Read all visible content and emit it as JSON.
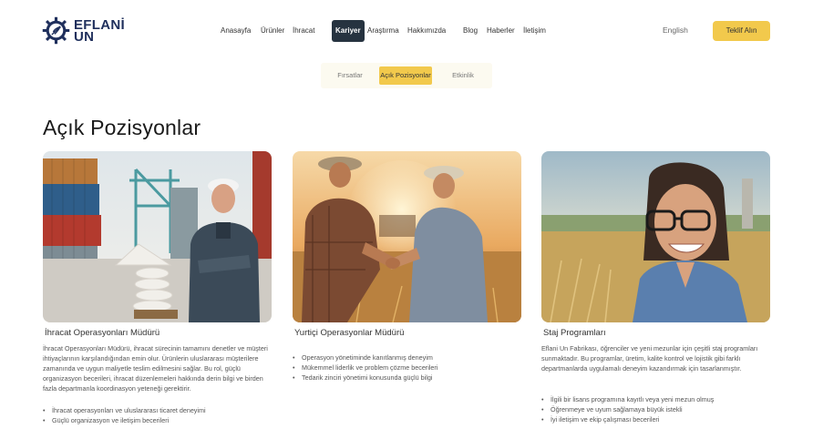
{
  "logo": {
    "line1": "EFLANİ",
    "line2": "UN"
  },
  "nav": {
    "items": [
      {
        "label": "Anasayfa"
      },
      {
        "label": "Ürünler"
      },
      {
        "label": "İhracat"
      },
      {
        "label": "Kariyer"
      },
      {
        "label": "Araştırma"
      },
      {
        "label": "Hakkımızda"
      },
      {
        "label": "Blog"
      },
      {
        "label": "Haberler"
      },
      {
        "label": "İletişim"
      }
    ],
    "active": "Kariyer"
  },
  "header": {
    "language": "English",
    "quote_button": "Teklif Alın"
  },
  "subtabs": [
    {
      "label": "Fırsatlar"
    },
    {
      "label": "Açık Pozisyonlar"
    },
    {
      "label": "Etkinlik"
    }
  ],
  "page": {
    "title": "Açık Pozisyonlar"
  },
  "colors": {
    "accent": "#f2c94c",
    "nav_active": "#263340",
    "brand": "#1f2f5c"
  },
  "cards": [
    {
      "title": "İhracat Operasyonları Müdürü",
      "description": "İhracat Operasyonları Müdürü, ihracat sürecinin tamamını denetler ve müşteri ihtiyaçlarının karşılandığından emin olur. Ürünlerin uluslararası müşterilere zamanında ve uygun maliyetle teslim edilmesini sağlar. Bu rol, güçlü organizasyon becerileri, ihracat düzenlemeleri hakkında derin bilgi ve birden fazla departmanla koordinasyon yeteneği gerektirir.",
      "bullets": [
        "İhracat operasyonları ve uluslararası ticaret deneyimi",
        "Güçlü organizasyon ve iletişim becerileri"
      ]
    },
    {
      "title": "Yurtiçi Operasyonlar Müdürü",
      "description": "",
      "bullets": [
        "Operasyon yönetiminde kanıtlanmış deneyim",
        "Mükemmel liderlik ve problem çözme becerileri",
        "Tedarik zinciri yönetimi konusunda güçlü bilgi"
      ]
    },
    {
      "title": "Staj Programları",
      "description": "Eflani Un Fabrikası, öğrenciler ve yeni mezunlar için çeşitli staj programları sunmaktadır. Bu programlar, üretim, kalite kontrol ve lojistik gibi farklı departmanlarda uygulamalı deneyim kazandırmak için tasarlanmıştır.",
      "bullets": [
        "İlgili bir lisans programına kayıtlı veya yeni mezun olmuş",
        "Öğrenmeye ve uyum sağlamaya büyük istekli",
        "İyi iletişim ve ekip çalışması becerileri"
      ]
    }
  ]
}
